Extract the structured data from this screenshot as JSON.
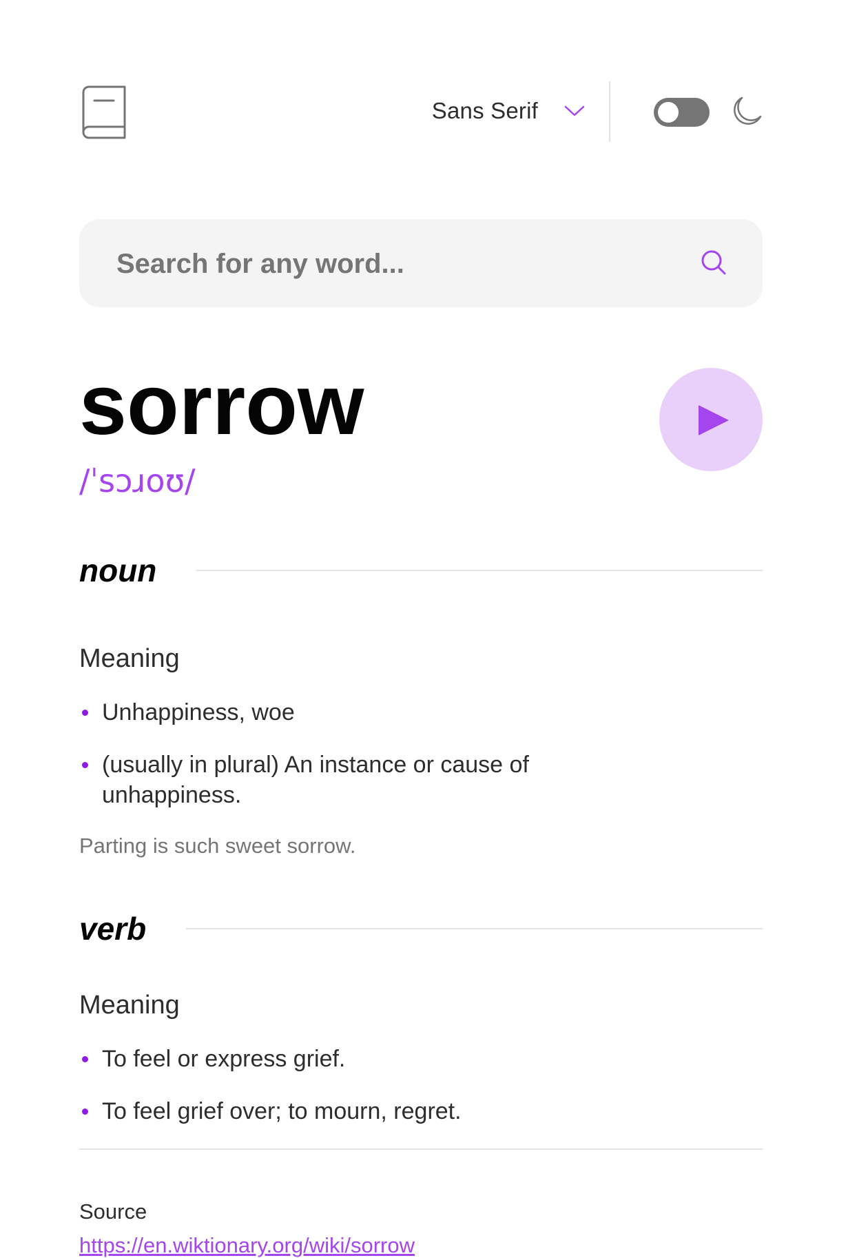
{
  "header": {
    "logo_icon": "book-icon",
    "font_select": {
      "selected": "Sans Serif",
      "icon": "chevron-down-icon"
    },
    "theme_toggle": {
      "state": "off",
      "icon": "moon-icon"
    }
  },
  "search": {
    "placeholder": "Search for any word...",
    "value": "",
    "icon": "search-icon"
  },
  "entry": {
    "word": "sorrow",
    "phonetic": "/ˈsɔɹoʊ/",
    "play_icon": "play-icon",
    "meanings": [
      {
        "part_of_speech": "noun",
        "label": "Meaning",
        "definitions": [
          "Unhappiness, woe",
          "(usually in plural) An instance or cause of unhappiness."
        ],
        "example": "Parting is such sweet sorrow."
      },
      {
        "part_of_speech": "verb",
        "label": "Meaning",
        "definitions": [
          "To feel or express grief.",
          "To feel grief over; to mourn, regret."
        ]
      }
    ],
    "source_label": "Source",
    "source_url": "https://en.wiktionary.org/wiki/sorrow"
  },
  "colors": {
    "accent": "#A445ED",
    "bullet": "#8F19E8",
    "play_bg": "#E9D0FA",
    "text": "#050505",
    "muted": "#757575",
    "search_bg": "#F4F4F4"
  }
}
